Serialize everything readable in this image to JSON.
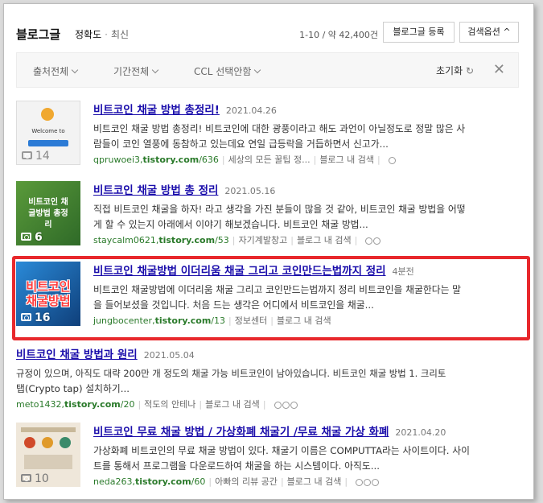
{
  "header": {
    "title": "블로그글",
    "sort_active": "정확도",
    "sort_other": "최신",
    "count": "1-10 / 약 42,400건",
    "register_button": "블로그글 등록",
    "options_button": "검색옵션 ^"
  },
  "filters": {
    "source": "출처전체",
    "period": "기간전체",
    "ccl": "CCL 선택안함",
    "reset": "초기화",
    "reset_icon": "refresh-icon",
    "close_icon": "close-icon"
  },
  "results": [
    {
      "title": "비트코인 채굴 방법 총정리!",
      "date": "2021.04.26",
      "desc_line1": "비트코인 채굴 방법 총정리! 비트코인에 대한 광풍이라고 해도 과언이 아닐정도로 정말 많은 사",
      "desc_line2": "람들이 코인 열풍에 동참하고 있는데요 연일 급등락을 거듭하면서 신고가...",
      "url_prefix": "qpruwoei3,",
      "url_domain": "tistory.com",
      "url_path": "/636",
      "source": "세상의 모든 꿀팁 정...",
      "search_in_blog": "블로그 내 검색",
      "thumb_count": "14",
      "thumb_text": "Welcome to CryptoTab!",
      "thumb_color": "#f4f4f4"
    },
    {
      "title": "비트코인 채굴 방법 총 정리",
      "date": "2021.05.16",
      "desc_line1": "직접 비트코인 채굴을 하자! 라고 생각을 가진 분들이 많을 것 같아, 비트코인 채굴 방법을 어떻",
      "desc_line2": "게 할 수 있는지 아래에서 이야기 해보겠습니다. 비트코인 채굴 방법...",
      "url_prefix": "staycalm0621,",
      "url_domain": "tistory.com",
      "url_path": "/53",
      "source": "자기계발창고",
      "search_in_blog": "블로그 내 검색",
      "thumb_count": "6",
      "thumb_text": "비트코인 채굴방법 총정리",
      "thumb_color": "#3e7a2e"
    },
    {
      "title": "비트코인 채굴방법 이더리움 채굴 그리고 코인만드는법까지 정리",
      "date": "4분전",
      "desc_line1": "비트코인 채굴방법에 이더리움 채굴 그리고 코인만드는법까지 정리 비트코인을 채굴한다는 말",
      "desc_line2": "을 들어보셨을 것입니다. 처음 드는 생각은 어디에서 비트코인을 채굴...",
      "url_prefix": "jungbocenter,",
      "url_domain": "tistory.com",
      "url_path": "/13",
      "source": "정보센터",
      "search_in_blog": "블로그 내 검색",
      "thumb_count": "16",
      "thumb_text": "비트코인 채굴방법",
      "thumb_color": "#1f6db0"
    },
    {
      "title": "비트코인 채굴 방법과 원리",
      "date": "2021.05.04",
      "desc_line1": "규정이 있으며, 아직도 대략 200만 개 정도의 채굴 가능 비트코인이 남아있습니다. 비트코인 채굴 방법 1. 크리토",
      "desc_line2": "탭(Crypto tap) 설치하기...",
      "url_prefix": "meto1432,",
      "url_domain": "tistory.com",
      "url_path": "/20",
      "source": "적도의 안테나",
      "search_in_blog": "블로그 내 검색"
    },
    {
      "title": "비트코인 무료 채굴 방법 / 가상화폐 채굴기 /무료 채굴 가상 화폐",
      "date": "2021.04.20",
      "desc_line1": "가상화폐 비트코인의 무료 채굴 방법이 있다. 채굴기 이름은 COMPUTTA라는 사이트이다. 사이",
      "desc_line2": "트를 통해서 프로그램을 다운로드하여 채굴을 하는 시스템이다. 아직도...",
      "url_prefix": "neda263,",
      "url_domain": "tistory.com",
      "url_path": "/60",
      "source": "아빠의 리뷰 공간",
      "search_in_blog": "블로그 내 검색",
      "thumb_count": "10",
      "thumb_text": "",
      "thumb_color": "#ece3d6"
    }
  ]
}
